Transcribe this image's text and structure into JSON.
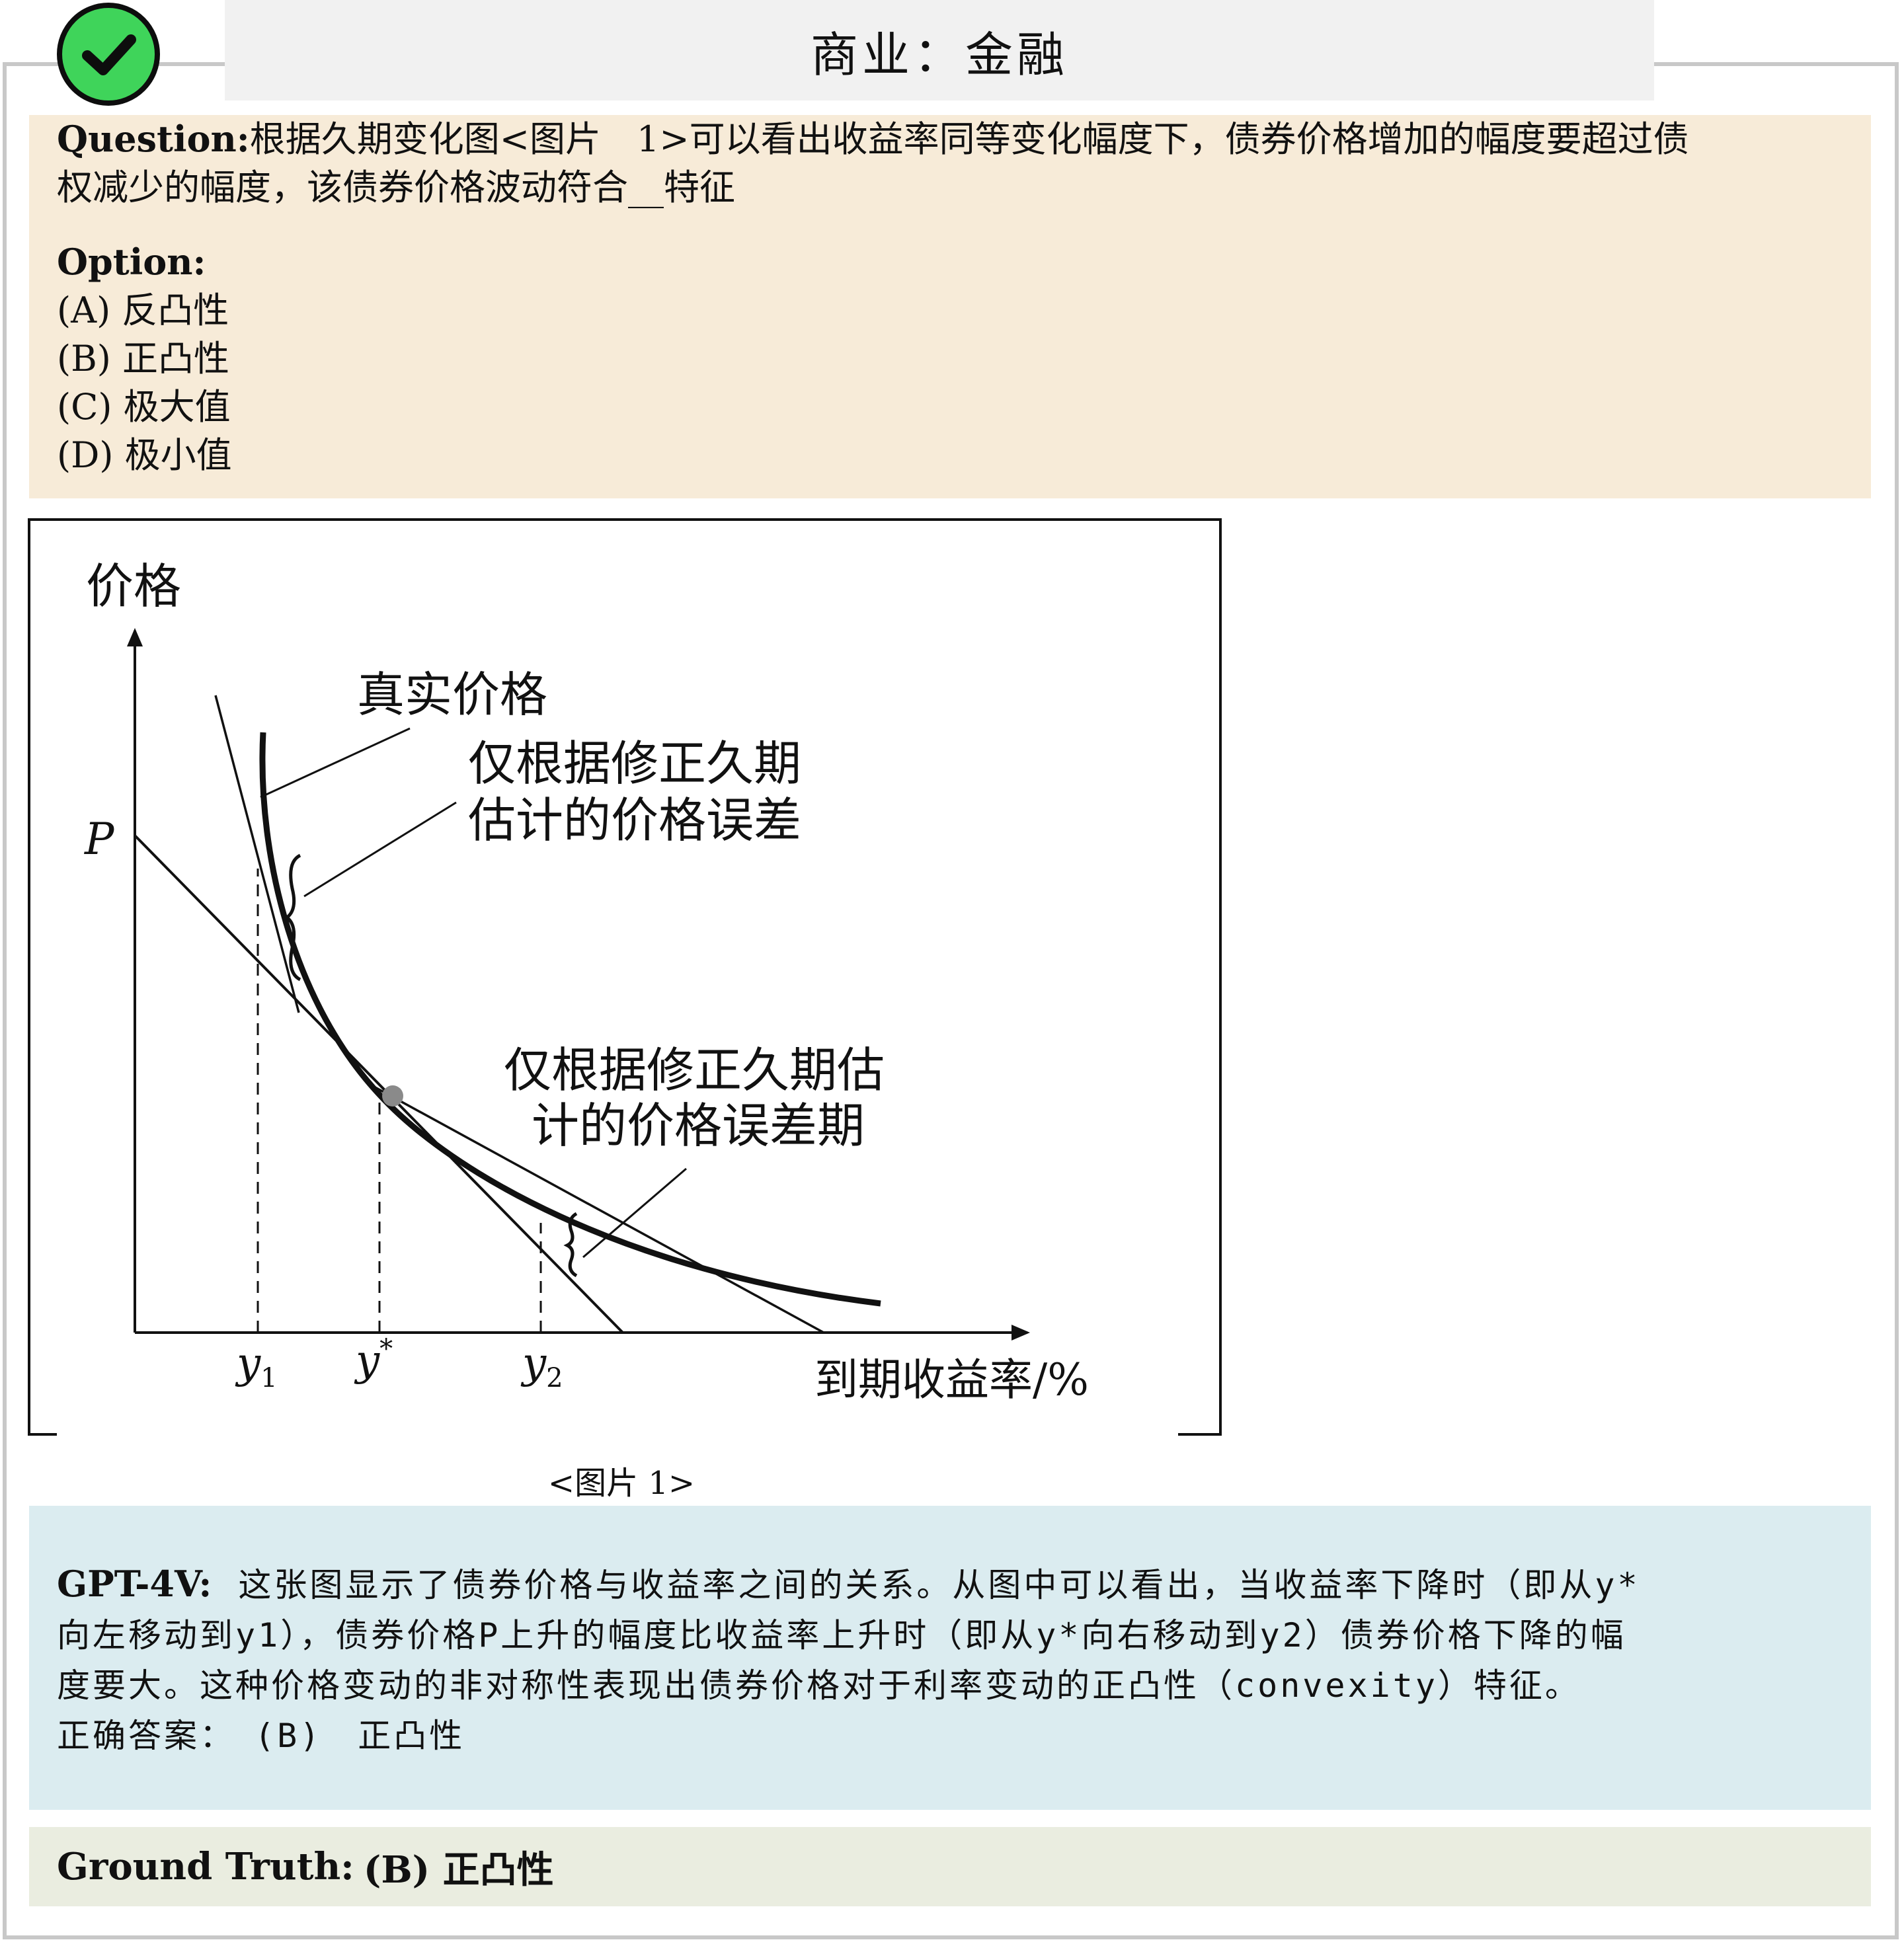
{
  "header": {
    "title": "商业：金融",
    "status_icon": "check-circle-icon",
    "status_color": "#3fd45a"
  },
  "question": {
    "label": "Question:",
    "line1": "根据久期变化图<图片　1>可以看出收益率同等变化幅度下，债券价格增加的幅度要超过债",
    "line2": "权减少的幅度，该债券价格波动符合__特征",
    "option_label": "Option:",
    "options": [
      "(A) 反凸性",
      "(B) 正凸性",
      "(C) 极大值",
      "(D) 极小值"
    ]
  },
  "figure": {
    "caption": "<图片 1>",
    "y_axis_label": "价格",
    "x_axis_label": "到期收益率/%",
    "p_label": "P",
    "curve_label": "真实价格",
    "error_label_upper_1": "仅根据修正久期",
    "error_label_upper_2": "估计的价格误差",
    "error_label_lower_1": "仅根据修正久期估",
    "error_label_lower_2": "计的价格误差期",
    "ticks": {
      "y1": "y",
      "y1_sub": "1",
      "ystar": "y",
      "ystar_sup": "*",
      "y2": "y",
      "y2_sub": "2"
    }
  },
  "answer": {
    "model_label": "GPT-4V:",
    "line1": "这张图显示了债券价格与收益率之间的关系。从图中可以看出，当收益率下降时（即从y*",
    "line2": "向左移动到y1），债券价格P上升的幅度比收益率上升时（即从y*向右移动到y2）债券价格下降的幅",
    "line3": "度要大。这种价格变动的非对称性表现出债券价格对于利率变动的正凸性（convexity）特征。",
    "line4": "正确答案：　(B)　正凸性"
  },
  "ground_truth": {
    "label": "Ground Truth:",
    "value": "(B) 正凸性"
  },
  "colors": {
    "question_bg": "#f7ebd8",
    "answer_bg": "#dbecf0",
    "ground_truth_bg": "#eaede0",
    "title_bg": "#f1f1f1"
  }
}
